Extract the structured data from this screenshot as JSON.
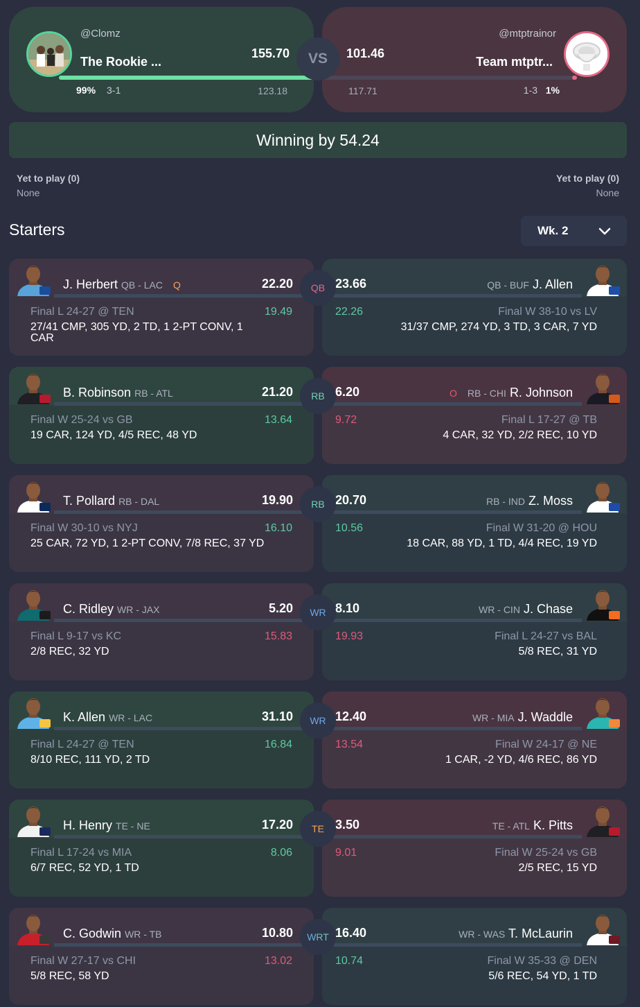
{
  "matchup": {
    "vs_label": "VS",
    "home": {
      "handle": "@Clomz",
      "team_name": "The Rookie ...",
      "score": "155.70",
      "win_pct": "99%",
      "record": "3-1",
      "projected": "123.18",
      "score_fill_fraction": 1.0
    },
    "away": {
      "handle": "@mtptrainor",
      "team_name": "Team mtptr...",
      "score": "101.46",
      "win_pct": "1%",
      "record": "1-3",
      "projected": "117.71",
      "score_fill_fraction": 0.02
    },
    "status": "Winning by 54.24"
  },
  "yet_to_play": {
    "left": {
      "title": "Yet to play (0)",
      "value": "None"
    },
    "right": {
      "title": "Yet to play (0)",
      "value": "None"
    }
  },
  "starters_title": "Starters",
  "week_selector": {
    "value": "Wk. 2",
    "icon": "chevron-down-icon"
  },
  "colors": {
    "win_green": "#2f4640",
    "lose_red": "#4a3442",
    "accent_green": "#6ee0a5",
    "accent_red": "#e36a87"
  },
  "rows": [
    {
      "slot": "QB",
      "left": {
        "name": "J. Herbert",
        "pos": "QB - LAC",
        "injury": "Q",
        "points": "22.20",
        "game": "Final L 24-27 @ TEN",
        "projected": "19.49",
        "stats": "27/41 CMP, 305 YD, 2 TD, 1 2-PT CONV, 1 CAR"
      },
      "right": {
        "name": "J. Allen",
        "pos": "QB - BUF",
        "injury": "",
        "points": "23.66",
        "game": "Final W 38-10 vs LV",
        "projected": "22.26",
        "stats": "31/37 CMP, 274 YD, 3 TD, 3 CAR, 7 YD"
      }
    },
    {
      "slot": "RB",
      "left": {
        "name": "B. Robinson",
        "pos": "RB - ATL",
        "injury": "",
        "points": "21.20",
        "game": "Final W 25-24 vs GB",
        "projected": "13.64",
        "stats": "19 CAR, 124 YD, 4/5 REC, 48 YD"
      },
      "right": {
        "name": "R. Johnson",
        "pos": "RB - CHI",
        "injury": "O",
        "points": "6.20",
        "game": "Final L 17-27 @ TB",
        "projected": "9.72",
        "stats": "4 CAR, 32 YD, 2/2 REC, 10 YD"
      }
    },
    {
      "slot": "RB",
      "left": {
        "name": "T. Pollard",
        "pos": "RB - DAL",
        "injury": "",
        "points": "19.90",
        "game": "Final W 30-10 vs NYJ",
        "projected": "16.10",
        "stats": "25 CAR, 72 YD, 1 2-PT CONV, 7/8 REC, 37 YD"
      },
      "right": {
        "name": "Z. Moss",
        "pos": "RB - IND",
        "injury": "",
        "points": "20.70",
        "game": "Final W 31-20 @ HOU",
        "projected": "10.56",
        "stats": "18 CAR, 88 YD, 1 TD, 4/4 REC, 19 YD"
      }
    },
    {
      "slot": "WR",
      "left": {
        "name": "C. Ridley",
        "pos": "WR - JAX",
        "injury": "",
        "points": "5.20",
        "game": "Final L 9-17 vs KC",
        "projected": "15.83",
        "stats": "2/8 REC, 32 YD"
      },
      "right": {
        "name": "J. Chase",
        "pos": "WR - CIN",
        "injury": "",
        "points": "8.10",
        "game": "Final L 24-27 vs BAL",
        "projected": "19.93",
        "stats": "5/8 REC, 31 YD"
      }
    },
    {
      "slot": "WR",
      "left": {
        "name": "K. Allen",
        "pos": "WR - LAC",
        "injury": "",
        "points": "31.10",
        "game": "Final L 24-27 @ TEN",
        "projected": "16.84",
        "stats": "8/10 REC, 111 YD, 2 TD"
      },
      "right": {
        "name": "J. Waddle",
        "pos": "WR - MIA",
        "injury": "",
        "points": "12.40",
        "game": "Final W 24-17 @ NE",
        "projected": "13.54",
        "stats": "1 CAR, -2 YD, 4/6 REC, 86 YD"
      }
    },
    {
      "slot": "TE",
      "left": {
        "name": "H. Henry",
        "pos": "TE - NE",
        "injury": "",
        "points": "17.20",
        "game": "Final L 17-24 vs MIA",
        "projected": "8.06",
        "stats": "6/7 REC, 52 YD, 1 TD"
      },
      "right": {
        "name": "K. Pitts",
        "pos": "TE - ATL",
        "injury": "",
        "points": "3.50",
        "game": "Final W 25-24 vs GB",
        "projected": "9.01",
        "stats": "2/5 REC, 15 YD"
      }
    },
    {
      "slot": "WRT",
      "left": {
        "name": "C. Godwin",
        "pos": "WR - TB",
        "injury": "",
        "points": "10.80",
        "game": "Final W 27-17 vs CHI",
        "projected": "13.02",
        "stats": "5/8 REC, 58 YD"
      },
      "right": {
        "name": "T. McLaurin",
        "pos": "WR - WAS",
        "injury": "",
        "points": "16.40",
        "game": "Final W 35-33 @ DEN",
        "projected": "10.74",
        "stats": "5/6 REC, 54 YD, 1 TD"
      }
    }
  ]
}
